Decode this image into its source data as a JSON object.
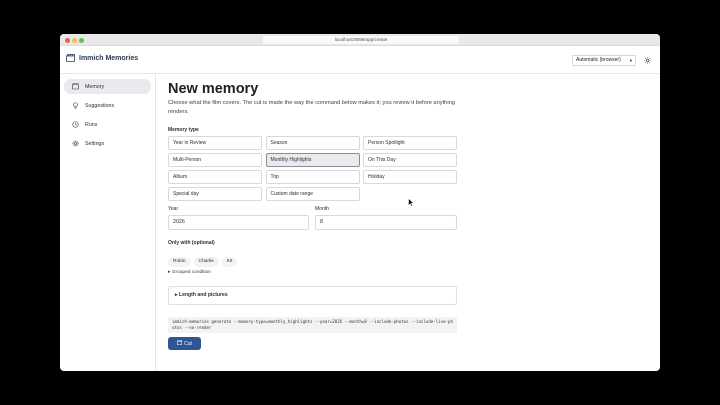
{
  "browser": {
    "url": "localhost:8099/app/create"
  },
  "app": {
    "name": "Immich Memories"
  },
  "appbar": {
    "mode_select": "Automatic (browser)"
  },
  "sidebar": {
    "items": [
      {
        "label": "Memory",
        "icon": "memory-icon",
        "active": true
      },
      {
        "label": "Suggestions",
        "icon": "lightbulb-icon",
        "active": false
      },
      {
        "label": "Runs",
        "icon": "history-icon",
        "active": false
      },
      {
        "label": "Settings",
        "icon": "gear-icon",
        "active": false
      }
    ]
  },
  "main": {
    "title": "New memory",
    "description": "Choose what the film covers. The cut is made the way the command below makes it; you review it before anything renders.",
    "memory_type_label": "Memory type",
    "memory_types": [
      "Year in Review",
      "Season",
      "Person Spotlight",
      "Multi-Person",
      "Monthly Highlights",
      "On This Day",
      "Album",
      "Trip",
      "Holiday",
      "Special day",
      "Custom date range"
    ],
    "selected_type": "Monthly Highlights",
    "year_label": "Year",
    "year_value": "2026",
    "month_label": "Month",
    "month_value": "8",
    "only_with_label": "Only with (optional)",
    "people": [
      "Robin",
      "Charlie",
      "Kit"
    ],
    "grouped_condition": "Grouped condition",
    "advanced_label": "Length and pictures",
    "command": "immich-memories generate --memory-type=monthly_highlights --year=2026 --month=8 --include-photos --include-live-photos --no-render",
    "cut_button": "Cut"
  },
  "colors": {
    "accent": "#2f5594",
    "selected_bg": "#e9eaee"
  }
}
